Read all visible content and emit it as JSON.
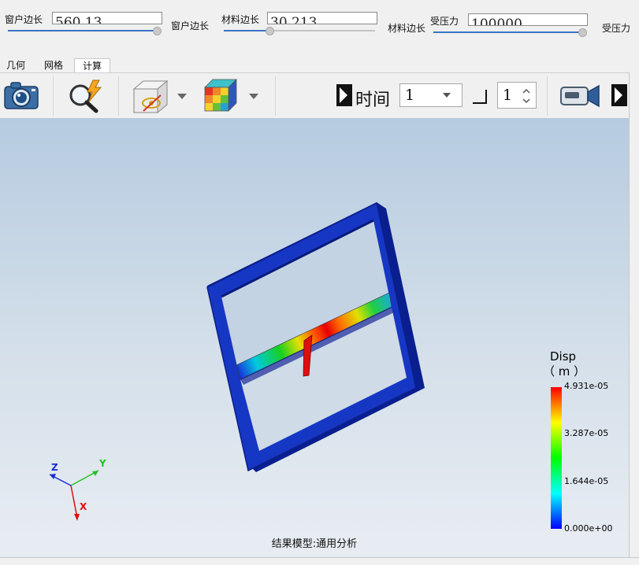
{
  "params": [
    {
      "label": "窗户边长",
      "value": "560.13",
      "slider_fraction": 0.99
    },
    {
      "label": "窗户边长"
    },
    {
      "label": "材料边长",
      "value": "30.213",
      "slider_fraction": 0.3
    },
    {
      "label": "材料边长"
    },
    {
      "label": "受压力",
      "value": "100000",
      "slider_fraction": 0.99
    },
    {
      "label": "受压力"
    }
  ],
  "tabs": [
    {
      "label": "几何",
      "active": false
    },
    {
      "label": "网格",
      "active": false
    },
    {
      "label": "计算",
      "active": true
    }
  ],
  "toolbar": {
    "icons": [
      "camera-icon",
      "search-flash-icon",
      "hide-cube-icon",
      "color-cube-icon",
      "video-camera-icon"
    ],
    "time_label": "时间",
    "time_value": "1",
    "step_value": "1"
  },
  "legend": {
    "title": "Disp",
    "unit": "（ m ）",
    "ticks": [
      "4.931e-05",
      "3.287e-05",
      "1.644e-05",
      "0.000e+00"
    ],
    "colors": [
      "#ff0000",
      "#ffff00",
      "#00ff00",
      "#00ffff",
      "#0000ff"
    ]
  },
  "triad": {
    "x": "X",
    "y": "Y",
    "z": "Z"
  },
  "status_text": "结果模型:通用分析"
}
